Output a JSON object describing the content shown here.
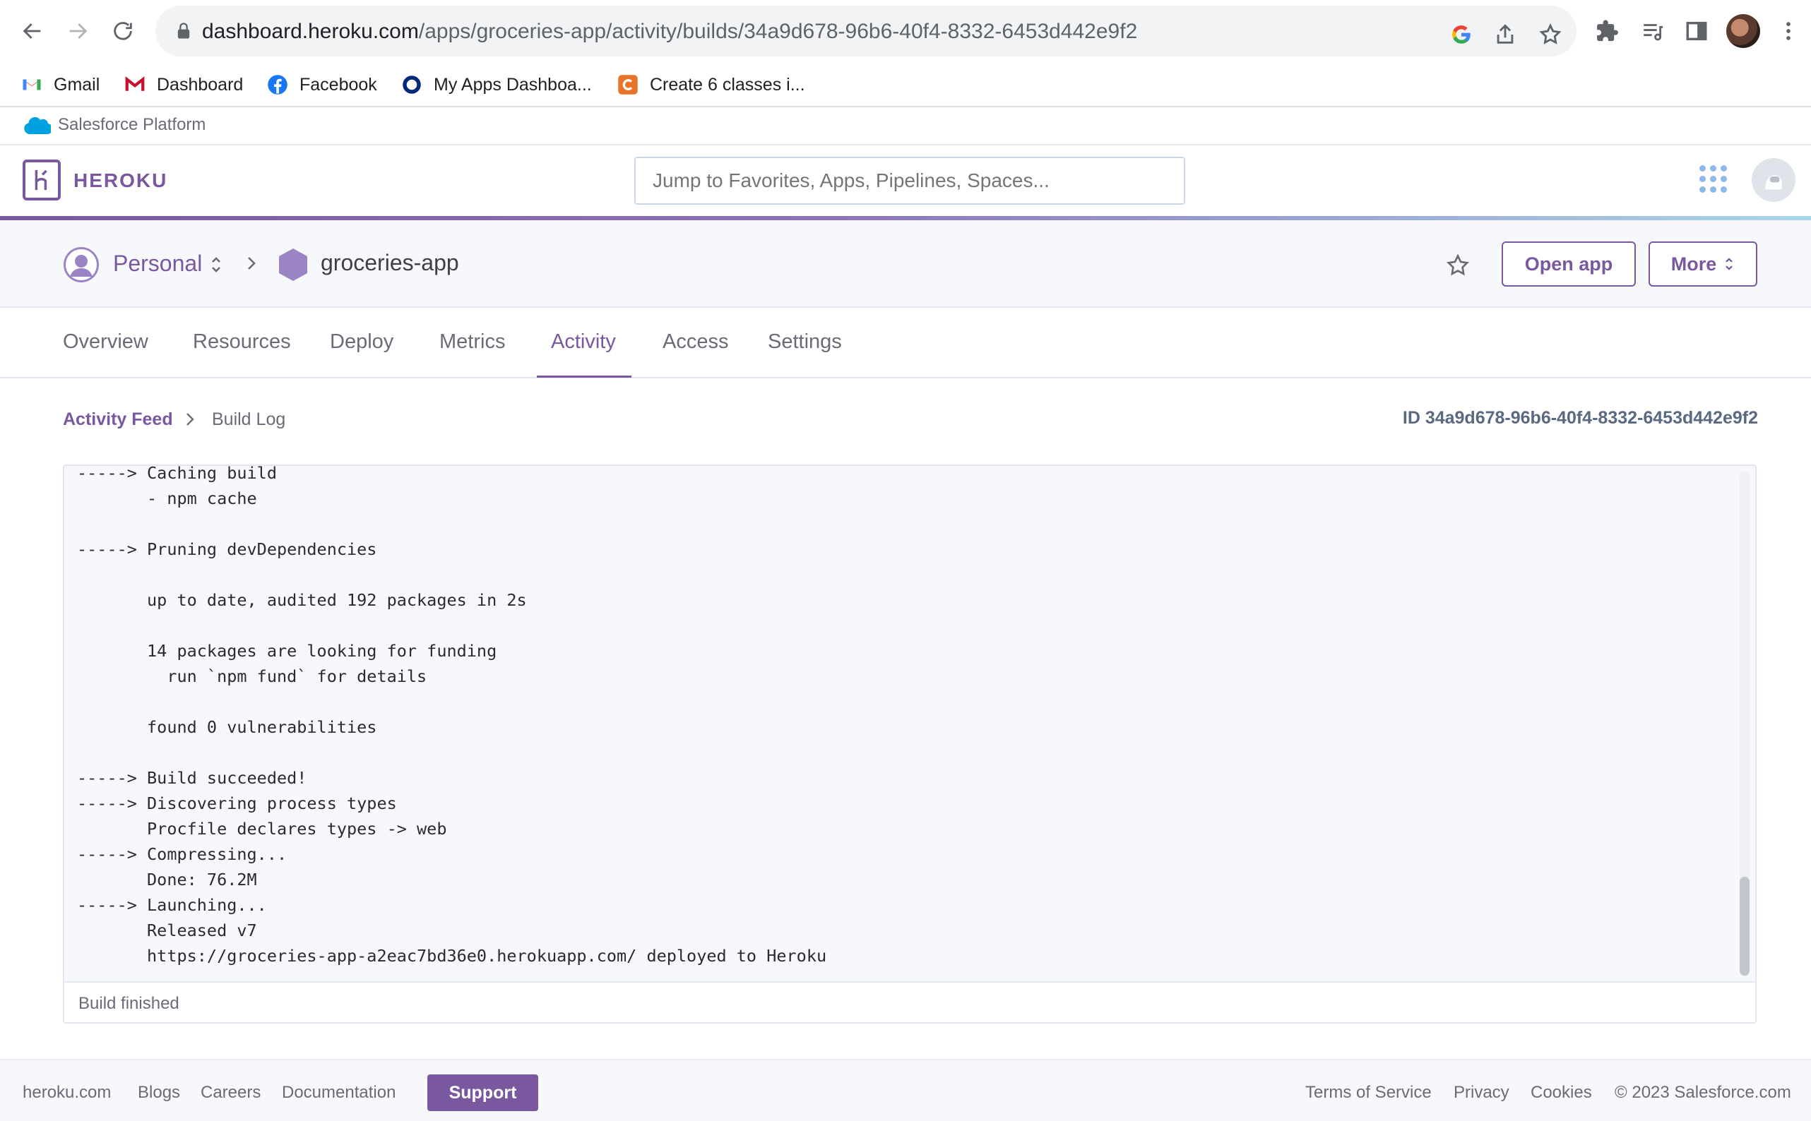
{
  "browser": {
    "url_host": "dashboard.heroku.com",
    "url_path": "/apps/groceries-app/activity/builds/34a9d678-96b6-40f4-8332-6453d442e9f2",
    "bookmarks": [
      {
        "label": "Gmail"
      },
      {
        "label": "Dashboard"
      },
      {
        "label": "Facebook"
      },
      {
        "label": "My Apps Dashboa..."
      },
      {
        "label": "Create 6 classes i..."
      }
    ]
  },
  "platform_bar": {
    "label": "Salesforce Platform"
  },
  "header": {
    "brand": "HEROKU",
    "search_placeholder": "Jump to Favorites, Apps, Pipelines, Spaces..."
  },
  "app_header": {
    "account": "Personal",
    "app_name": "groceries-app",
    "open_app_label": "Open app",
    "more_label": "More"
  },
  "tabs": [
    {
      "label": "Overview"
    },
    {
      "label": "Resources"
    },
    {
      "label": "Deploy"
    },
    {
      "label": "Metrics"
    },
    {
      "label": "Activity",
      "active": true
    },
    {
      "label": "Access"
    },
    {
      "label": "Settings"
    }
  ],
  "breadcrumb": {
    "parent": "Activity Feed",
    "current": "Build Log",
    "build_id": "ID 34a9d678-96b6-40f4-8332-6453d442e9f2"
  },
  "log": {
    "lines": [
      "-----> Caching build",
      "       - npm cache",
      "",
      "-----> Pruning devDependencies",
      "",
      "       up to date, audited 192 packages in 2s",
      "",
      "       14 packages are looking for funding",
      "         run `npm fund` for details",
      "",
      "       found 0 vulnerabilities",
      "",
      "-----> Build succeeded!",
      "-----> Discovering process types",
      "       Procfile declares types -> web",
      "-----> Compressing...",
      "       Done: 76.2M",
      "-----> Launching...",
      "       Released v7",
      "       https://groceries-app-a2eac7bd36e0.herokuapp.com/ deployed to Heroku"
    ],
    "status": "Build finished"
  },
  "footer": {
    "links_left": [
      "heroku.com",
      "Blogs",
      "Careers",
      "Documentation"
    ],
    "support_label": "Support",
    "links_right": [
      "Terms of Service",
      "Privacy",
      "Cookies",
      "© 2023 Salesforce.com"
    ]
  },
  "colors": {
    "brand_purple": "#79589f",
    "text": "#3f3f44",
    "muted": "#6b6b77"
  }
}
